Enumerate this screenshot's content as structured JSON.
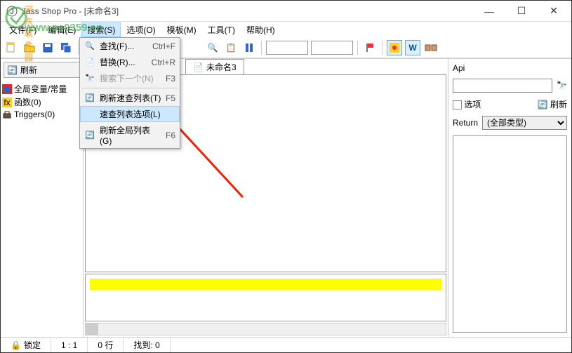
{
  "window": {
    "title": "Jass Shop Pro - [未命名3]"
  },
  "menubar": {
    "file": "文件(F)",
    "edit": "编辑(E)",
    "search": "搜索(S)",
    "options": "选项(O)",
    "template": "模板(M)",
    "tools": "工具(T)",
    "help": "帮助(H)"
  },
  "dropdown": {
    "find": {
      "label": "查找(F)...",
      "shortcut": "Ctrl+F"
    },
    "replace": {
      "label": "替换(R)...",
      "shortcut": "Ctrl+R"
    },
    "findnext": {
      "label": "搜索下一个(N)",
      "shortcut": "F3"
    },
    "refreshquick": {
      "label": "刷新速查列表(T)",
      "shortcut": "F5"
    },
    "quickoptions": {
      "label": "速查列表选项(L)",
      "shortcut": ""
    },
    "refreshglobal": {
      "label": "刷新全局列表(G)",
      "shortcut": "F6"
    }
  },
  "left": {
    "refresh": "刷新",
    "items": {
      "globals": "全局变量/常量",
      "functions": "函数(0)",
      "triggers": "Triggers(0)"
    }
  },
  "tabs": {
    "t1": "未命名3"
  },
  "right": {
    "api": "Api",
    "options": "选项",
    "refresh": "刷新",
    "return": "Return",
    "return_sel": "(全部类型)"
  },
  "status": {
    "lock": "锁定",
    "pos": "1 : 1",
    "lines": "0 行",
    "found": "找到: 0"
  },
  "watermark": {
    "a": "河东软件园",
    "b": "www.pc0359.cn"
  }
}
